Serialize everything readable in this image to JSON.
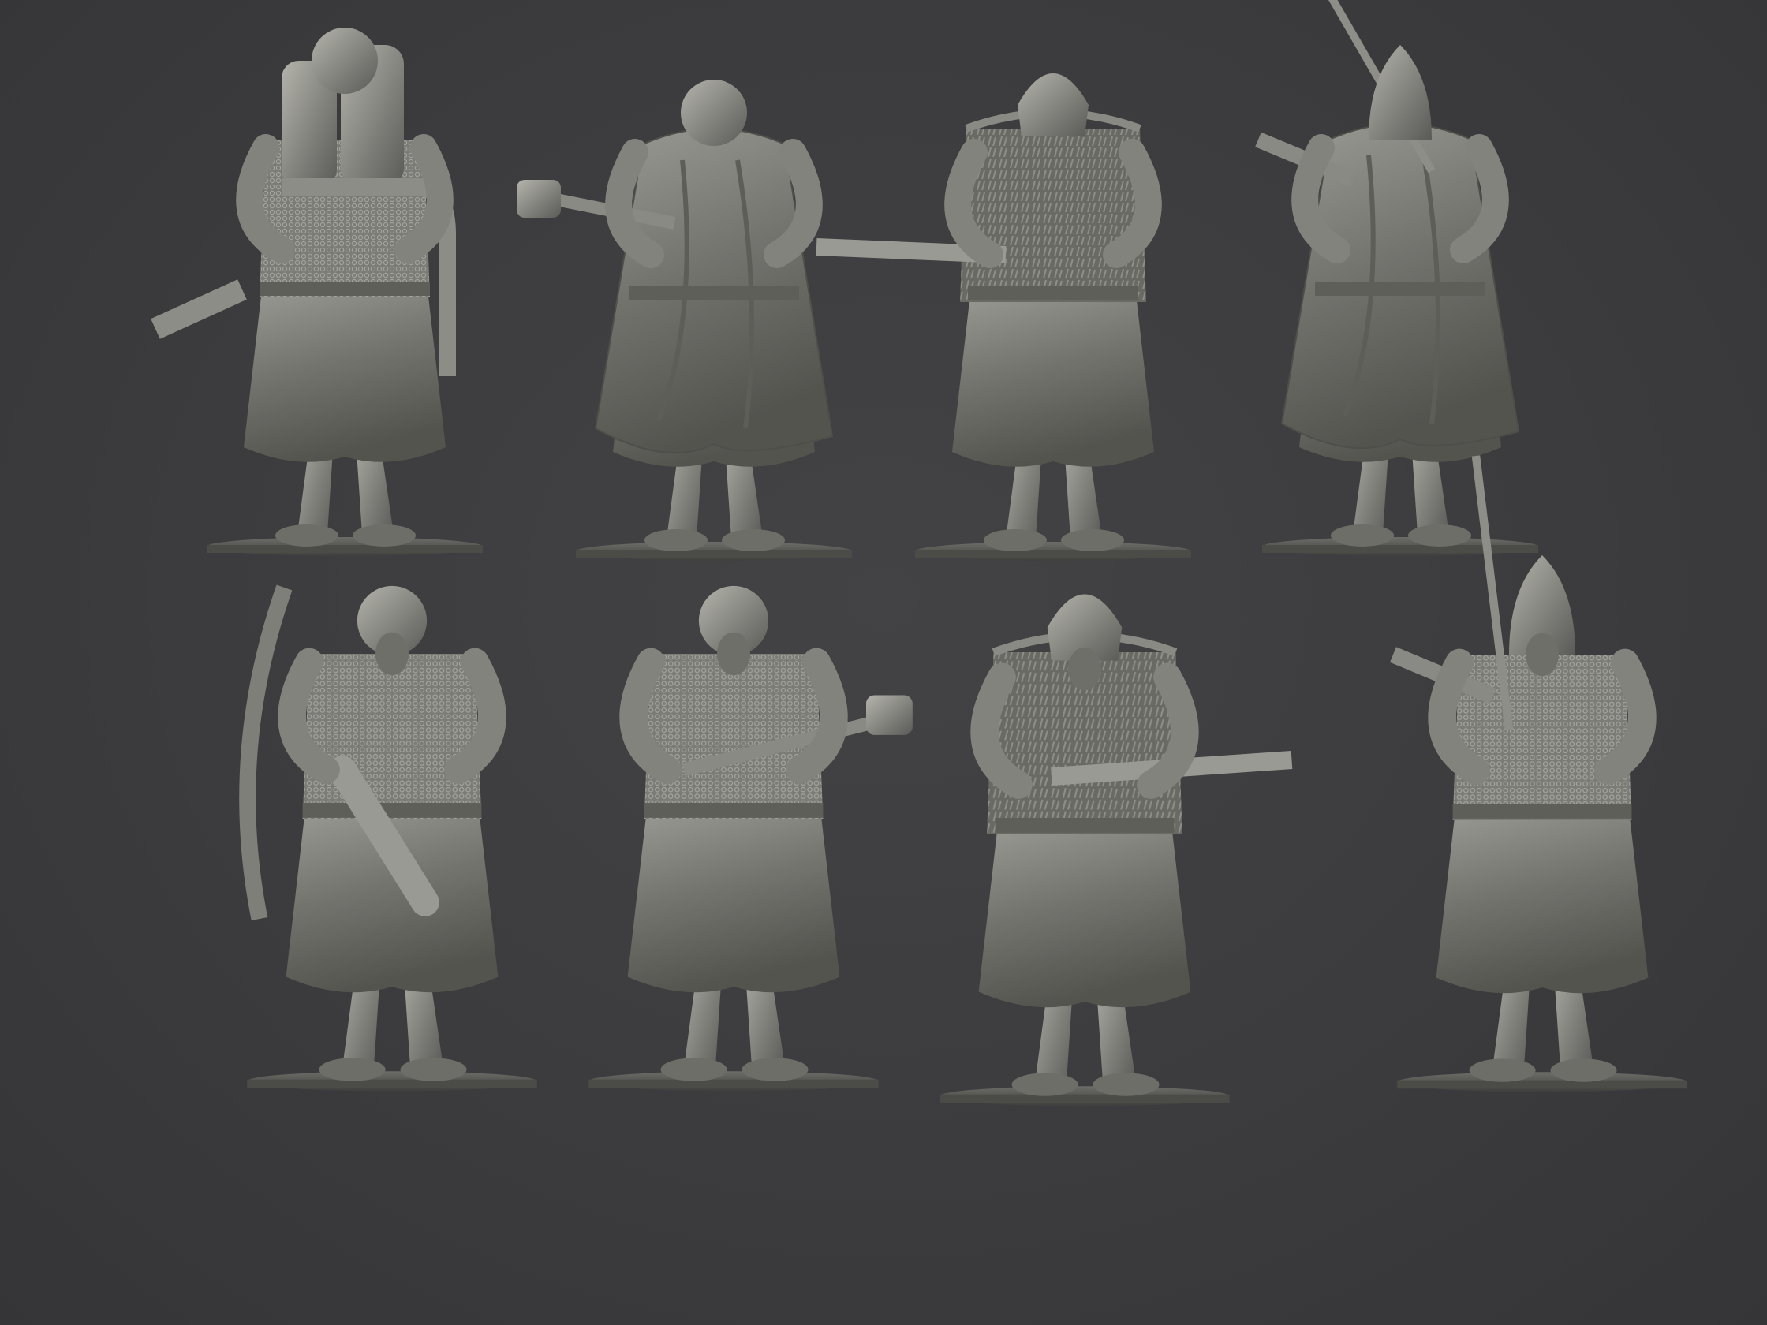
{
  "scene": {
    "background_color": "#3c3c3e",
    "material_color": "#8f8f89",
    "highlight_color": "#b9b9b2",
    "shadow_color": "#4a4a48",
    "base_color": "#5b5b58"
  },
  "miniatures": [
    {
      "id": "flamer-back",
      "view": "back",
      "pose": "flamer"
    },
    {
      "id": "mace-back",
      "view": "back",
      "pose": "mace"
    },
    {
      "id": "shotgun-back",
      "view": "back",
      "pose": "shotgun"
    },
    {
      "id": "sword-back",
      "view": "back",
      "pose": "sword"
    },
    {
      "id": "flamer-front",
      "view": "front",
      "pose": "flamer"
    },
    {
      "id": "mace-front",
      "view": "front",
      "pose": "mace"
    },
    {
      "id": "shotgun-front",
      "view": "front",
      "pose": "shotgun"
    },
    {
      "id": "sword-front",
      "view": "front",
      "pose": "sword"
    }
  ]
}
